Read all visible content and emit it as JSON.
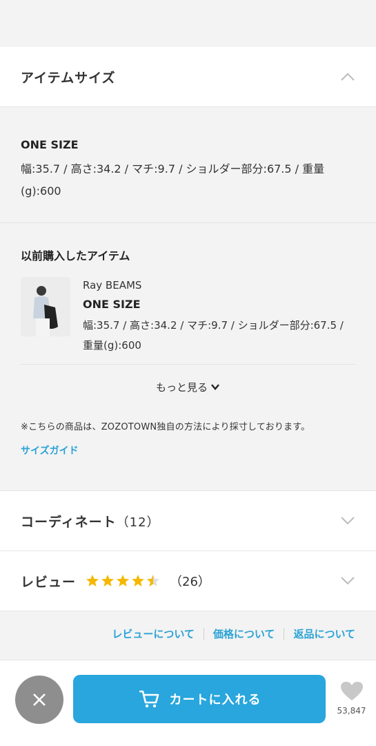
{
  "item_size": {
    "header_title": "アイテムサイズ",
    "size_name": "ONE SIZE",
    "size_detail": "幅:35.7 / 高さ:34.2 / マチ:9.7 / ショルダー部分:67.5 / 重量(g):600"
  },
  "purchased": {
    "title": "以前購入したアイテム",
    "brand": "Ray BEAMS",
    "size": "ONE SIZE",
    "detail": "幅:35.7 / 高さ:34.2 / マチ:9.7 / ショルダー部分:67.5 / 重量(g):600"
  },
  "more_label": "もっと見る",
  "note": "※こちらの商品は、ZOZOTOWN独自の方法により採寸しております。",
  "size_guide_label": "サイズガイド",
  "coordinate": {
    "label": "コーディネート",
    "count": "（12）"
  },
  "review": {
    "label": "レビュー",
    "count": "（26）",
    "rating": 4.5,
    "max": 5
  },
  "links": [
    "レビューについて",
    "価格について",
    "返品について"
  ],
  "bottom": {
    "cart_label": "カートに入れる",
    "favorite_count": "53,847"
  },
  "colors": {
    "accent": "#29a6dd",
    "link": "#2aa3d6",
    "star": "#f5b800"
  }
}
